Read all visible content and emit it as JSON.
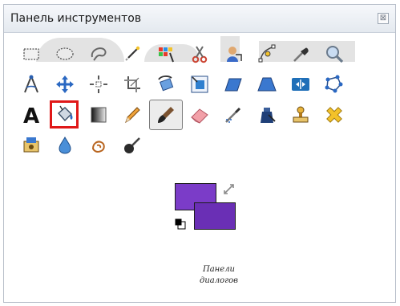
{
  "window": {
    "title": "Панель инструментов"
  },
  "close_glyph": "⊠",
  "tools": [
    {
      "name": "rect-select-icon"
    },
    {
      "name": "ellipse-select-icon"
    },
    {
      "name": "free-select-icon"
    },
    {
      "name": "fuzzy-select-icon"
    },
    {
      "name": "select-by-color-icon"
    },
    {
      "name": "scissors-select-icon"
    },
    {
      "name": "foreground-select-icon"
    },
    {
      "name": "paths-icon"
    },
    {
      "name": "color-picker-icon"
    },
    {
      "name": "zoom-icon"
    },
    {
      "name": "measure-icon"
    },
    {
      "name": "move-icon"
    },
    {
      "name": "align-icon"
    },
    {
      "name": "crop-icon"
    },
    {
      "name": "rotate-icon"
    },
    {
      "name": "scale-icon"
    },
    {
      "name": "shear-icon"
    },
    {
      "name": "perspective-icon"
    },
    {
      "name": "flip-icon"
    },
    {
      "name": "cage-transform-icon"
    },
    {
      "name": "text-icon"
    },
    {
      "name": "bucket-fill-icon"
    },
    {
      "name": "blend-icon"
    },
    {
      "name": "pencil-icon"
    },
    {
      "name": "paintbrush-icon"
    },
    {
      "name": "eraser-icon"
    },
    {
      "name": "airbrush-icon"
    },
    {
      "name": "ink-icon"
    },
    {
      "name": "clone-icon"
    },
    {
      "name": "healing-icon"
    },
    {
      "name": "perspective-clone-icon"
    },
    {
      "name": "blur-sharpen-icon"
    },
    {
      "name": "smudge-icon"
    },
    {
      "name": "dodge-burn-icon"
    }
  ],
  "active_tool": "paintbrush-icon",
  "highlighted_tool": "bucket-fill-icon",
  "colors": {
    "foreground": "#7b3cc8",
    "background": "#6a2fb5",
    "highlight": "#e01818"
  },
  "dialogs_label": [
    "Панели",
    "диалогов"
  ]
}
